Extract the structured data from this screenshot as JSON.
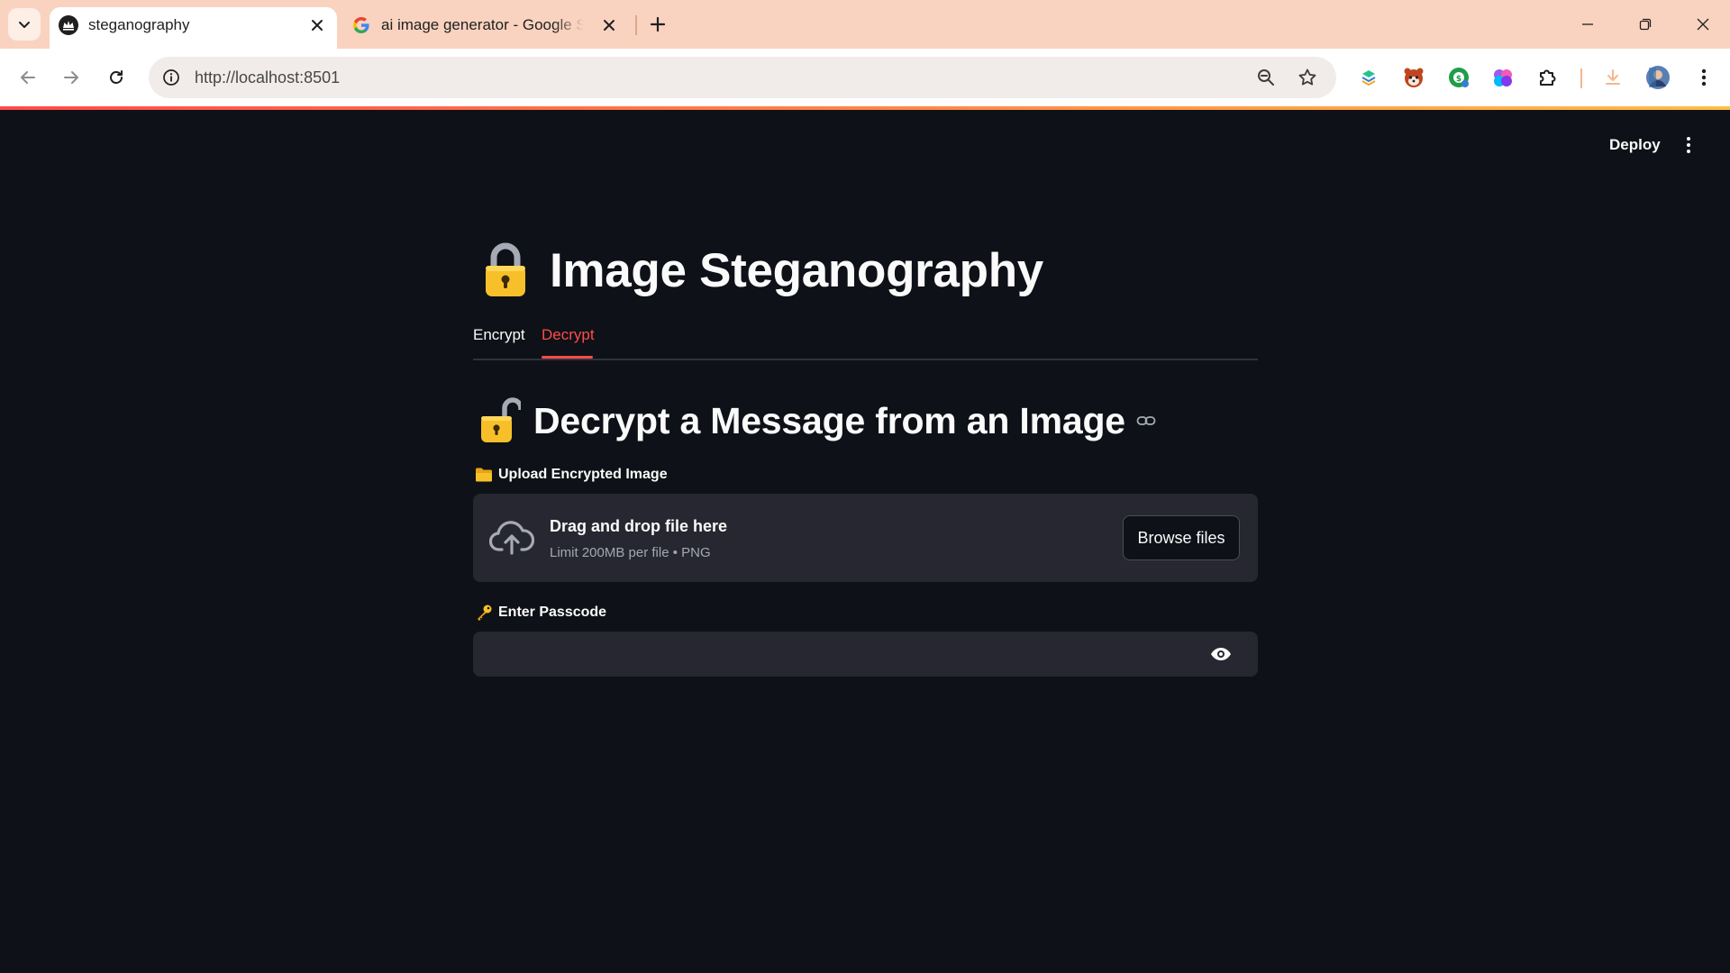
{
  "browser": {
    "tabs": [
      {
        "title": "steganography",
        "active": true
      },
      {
        "title": "ai image generator - Google Search",
        "active": false
      }
    ],
    "url": "http://localhost:8501",
    "colors": {
      "tabstrip": "#f9d3bf",
      "accent_bar_start": "#ff4b4b",
      "accent_bar_end": "#ffbd45"
    },
    "icons": {
      "toolbar": [
        "back-arrow-icon",
        "forward-arrow-icon",
        "reload-icon",
        "site-info-icon",
        "zoom-icon",
        "bookmark-star-icon"
      ],
      "extensions": [
        "extension-1-icon",
        "red-panda-extension-icon",
        "extension-3-icon",
        "brain-extension-icon",
        "puzzle-extensions-icon",
        "download-icon",
        "profile-avatar",
        "kebab-menu-icon"
      ]
    }
  },
  "app": {
    "deploy_label": "Deploy",
    "title": "Image Steganography",
    "tabs": [
      {
        "label": "Encrypt",
        "selected": false
      },
      {
        "label": "Decrypt",
        "selected": true
      }
    ],
    "subheader": "Decrypt a Message from an Image",
    "upload": {
      "label": "Upload Encrypted Image",
      "drop_title": "Drag and drop file here",
      "drop_subtitle": "Limit 200MB per file • PNG",
      "browse_label": "Browse files"
    },
    "passcode": {
      "label": "Enter Passcode",
      "value": ""
    },
    "colors": {
      "background": "#0e1117",
      "widget": "#262730",
      "accent": "#ff4b4b",
      "emoji_lock": "#f7c02a"
    }
  }
}
